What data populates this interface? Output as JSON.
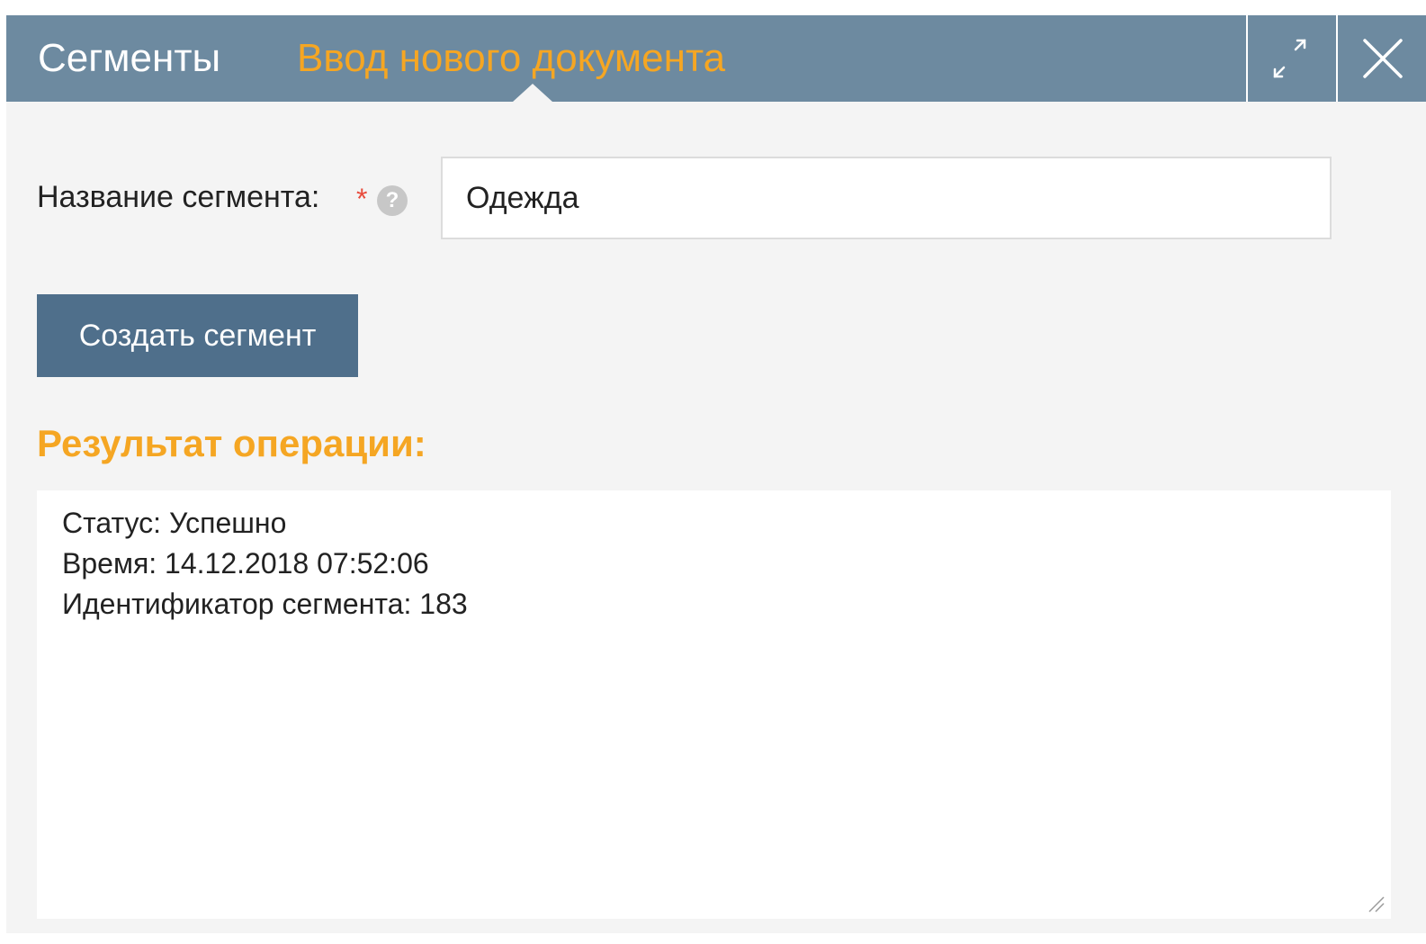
{
  "window": {
    "tabs": [
      {
        "label": "Сегменты",
        "active": false
      },
      {
        "label": "Ввод нового документа",
        "active": true
      }
    ],
    "controls": {
      "maximize_icon": "expand-icon",
      "close_icon": "close-icon"
    }
  },
  "form": {
    "name_label": "Название сегмента:",
    "required_mark": "*",
    "help_glyph": "?",
    "name_value": "Одежда",
    "create_button": "Создать сегмент"
  },
  "result": {
    "heading": "Результат операции:",
    "lines": [
      "Статус: Успешно",
      "Время: 14.12.2018 07:52:06",
      "Идентификатор сегмента: 183"
    ]
  },
  "colors": {
    "titlebar": "#6d8aa0",
    "accent": "#f5a623",
    "button": "#4f6f8b",
    "panel": "#f4f4f4",
    "required": "#e84c3d"
  }
}
